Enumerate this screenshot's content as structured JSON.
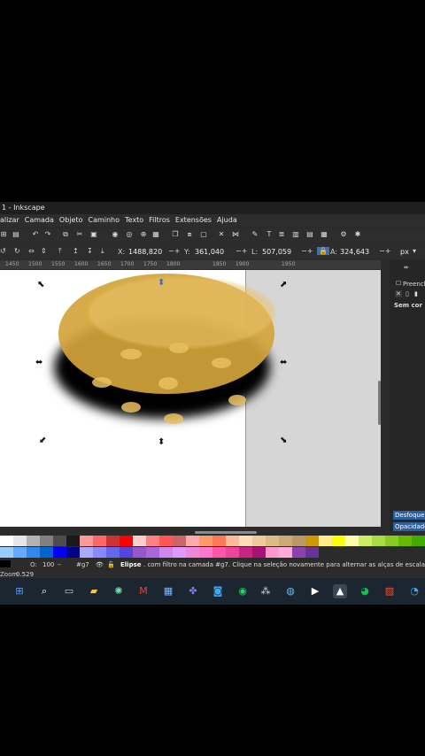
{
  "window": {
    "title": "1 - Inkscape"
  },
  "menu": [
    "alizar",
    "Camada",
    "Objeto",
    "Caminho",
    "Texto",
    "Filtros",
    "Extensões",
    "Ajuda"
  ],
  "toolbar": {
    "x_label": "X:",
    "x_value": "1488,820",
    "y_label": "Y:",
    "y_value": "361,040",
    "w_label": "L:",
    "w_value": "507,059",
    "h_label": "A:",
    "h_value": "324,643",
    "unit": "px"
  },
  "ruler": [
    "1450",
    "1500",
    "1550",
    "1600",
    "1650",
    "1700",
    "1750",
    "1800",
    "1850",
    "1900",
    "1950"
  ],
  "fillstroke": {
    "tab_label": "Preench",
    "no_paint": "Sem cor"
  },
  "panel": {
    "blur_label": "Desfoque (",
    "opacity_label": "Opacidade"
  },
  "status": {
    "opacity_label": "O:",
    "opacity_value": "100",
    "layer": "#g7",
    "zoom_label": "Zoom",
    "zoom_value": "0.529",
    "message_bold": "Elipse",
    "message_rest": ". com filtro na camada #g7. Clique na seleção novamente para alternar as alças de escala/rotação"
  },
  "colors": {
    "accent": "#2c5f9e",
    "ellipse_fill": "#d4a43a",
    "ellipse_light": "#e9c46a",
    "spot": "#e8bf5f",
    "shadow": "#000000"
  },
  "taskbar_icons": [
    "windows-icon",
    "search-icon",
    "taskview-icon",
    "file-explorer-icon",
    "chatgpt-icon",
    "gmail-icon",
    "store-icon",
    "teams-icon",
    "app-icon",
    "whatsapp-icon",
    "app-icon-2",
    "browser-icon",
    "media-player-icon",
    "inkscape-icon",
    "spotify-icon",
    "app-icon-3",
    "edge-icon"
  ]
}
